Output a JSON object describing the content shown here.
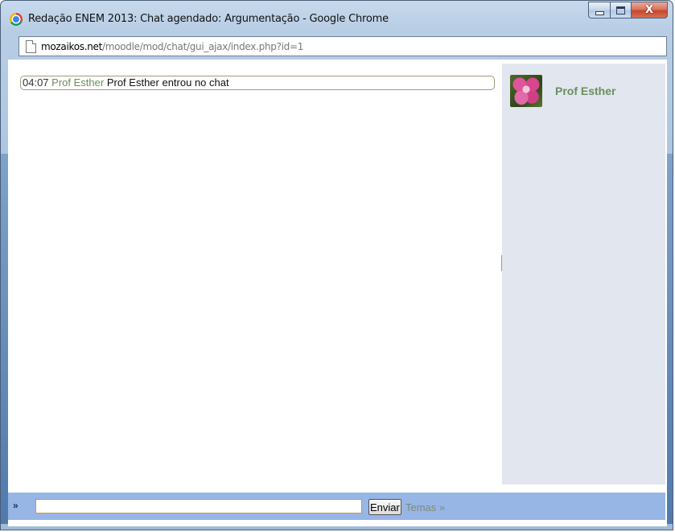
{
  "window": {
    "title": "Redação ENEM 2013: Chat agendado: Argumentação - Google Chrome",
    "buttons": {
      "minimize": "–",
      "maximize": "□",
      "close": "X"
    }
  },
  "address": {
    "host": "mozaikos.net",
    "path": "/moodle/mod/chat/gui_ajax/index.php?id=1"
  },
  "messages": [
    {
      "time": "04:07",
      "user": "Prof Esther",
      "text": "Prof Esther entrou no chat"
    }
  ],
  "users": [
    {
      "name": "Prof Esther"
    }
  ],
  "input": {
    "prefix": "»",
    "value": "",
    "send_label": "Enviar",
    "themes_label": "Temas »"
  },
  "colors": {
    "username": "#6b8e5e",
    "user_panel_bg": "#e2e6ee",
    "input_bar_bg": "#97b6e6"
  }
}
